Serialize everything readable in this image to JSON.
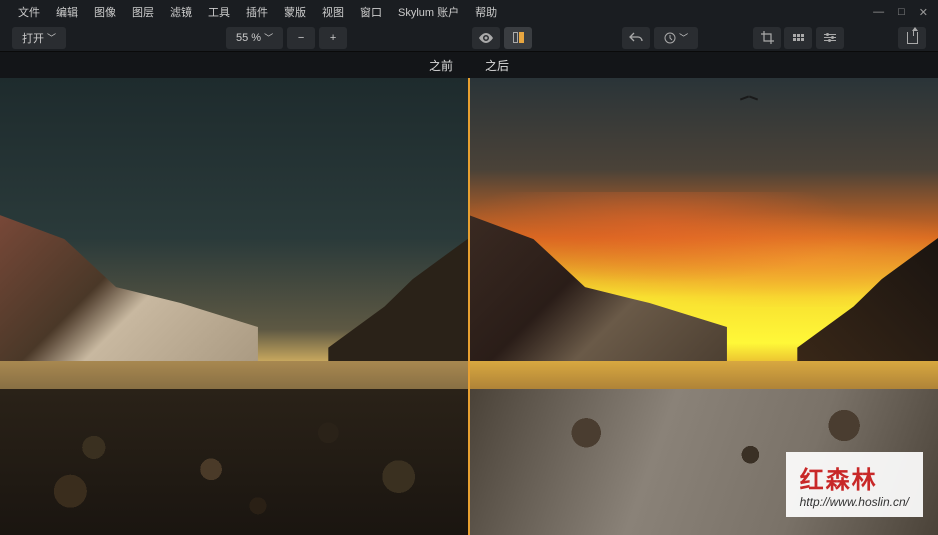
{
  "menu": {
    "file": "文件",
    "edit": "编辑",
    "image": "图像",
    "layer": "图层",
    "filter": "滤镜",
    "tools": "工具",
    "plugins": "插件",
    "masks": "蒙版",
    "view": "视图",
    "window": "窗口",
    "account": "Skylum 账户",
    "help": "帮助"
  },
  "toolbar": {
    "open_label": "打开",
    "zoom_value": "55 %"
  },
  "compare": {
    "before_label": "之前",
    "after_label": "之后"
  },
  "watermark": {
    "title": "红森林",
    "url": "http://www.hoslin.cn/"
  },
  "window_controls": {
    "minimize": "—",
    "maximize": "□",
    "close": "✕"
  }
}
